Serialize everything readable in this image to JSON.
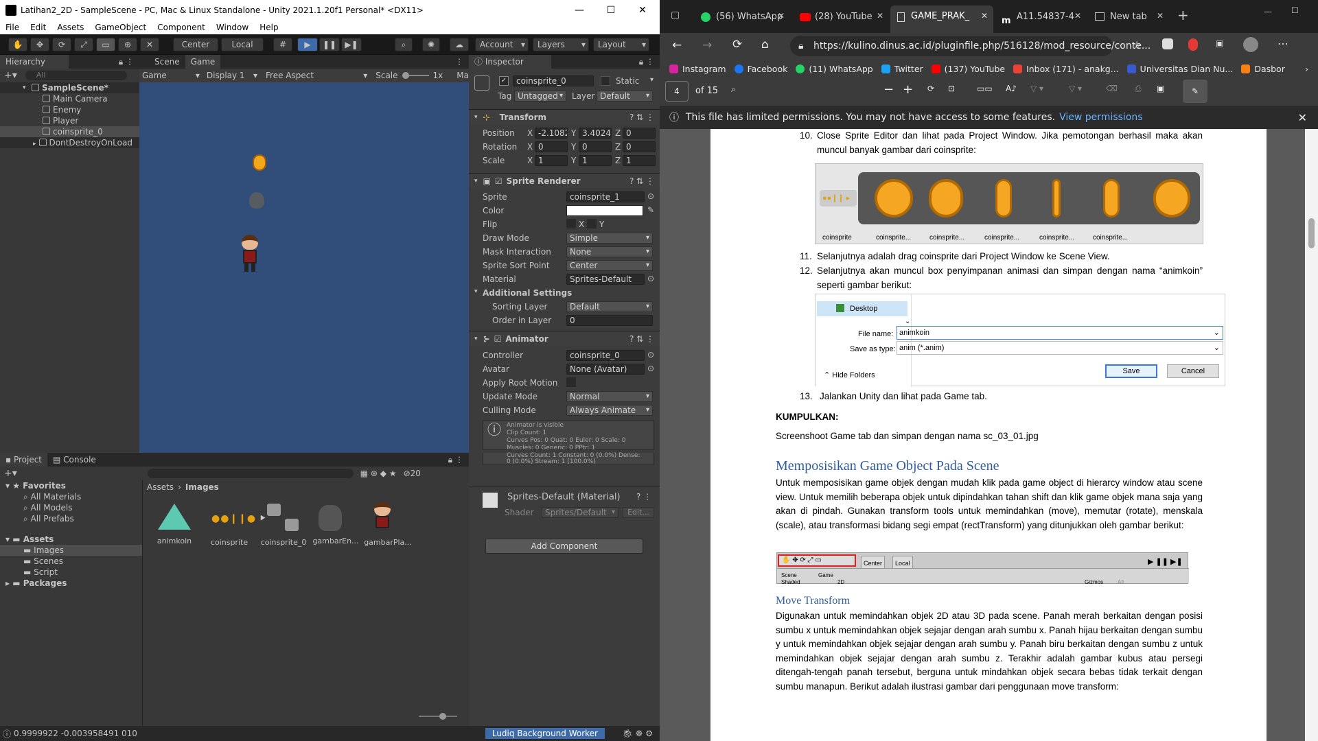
{
  "unity": {
    "title": "Latihan2_2D - SampleScene - PC, Mac & Linux Standalone - Unity 2021.1.20f1 Personal* <DX11>",
    "menu": [
      "File",
      "Edit",
      "Assets",
      "GameObject",
      "Component",
      "Window",
      "Help"
    ],
    "toolbar": {
      "center": "Center",
      "local": "Local",
      "account": "Account",
      "layers": "Layers",
      "layout": "Layout"
    },
    "hierarchy": {
      "tab": "Hierarchy",
      "search_placeholder": "All",
      "items": [
        "SampleScene*",
        "Main Camera",
        "Enemy",
        "Player",
        "coinsprite_0",
        "DontDestroyOnLoad"
      ]
    },
    "scene_tabs": {
      "scene": "Scene",
      "game": "Game"
    },
    "game_bar": {
      "game": "Game",
      "display": "Display 1",
      "aspect": "Free Aspect",
      "scale_label": "Scale",
      "scale_value": "1x",
      "maximize": "Ma"
    },
    "inspector": {
      "tab": "Inspector",
      "object_name": "coinsprite_0",
      "static": "Static",
      "tag_label": "Tag",
      "tag_value": "Untagged",
      "layer_label": "Layer",
      "layer_value": "Default",
      "transform": {
        "title": "Transform",
        "position_label": "Position",
        "pos_x": "-2.1082",
        "pos_y": "3.4024",
        "pos_z": "0",
        "rotation_label": "Rotation",
        "rot_x": "0",
        "rot_y": "0",
        "rot_z": "0",
        "scale_label": "Scale",
        "sc_x": "1",
        "sc_y": "1",
        "sc_z": "1"
      },
      "sprite_renderer": {
        "title": "Sprite Renderer",
        "sprite_label": "Sprite",
        "sprite_value": "coinsprite_1",
        "color_label": "Color",
        "flip_label": "Flip",
        "flip_x": "X",
        "flip_y": "Y",
        "draw_mode_label": "Draw Mode",
        "draw_mode": "Simple",
        "mask_label": "Mask Interaction",
        "mask": "None",
        "sort_point_label": "Sprite Sort Point",
        "sort_point": "Center",
        "material_label": "Material",
        "material": "Sprites-Default",
        "additional": "Additional Settings",
        "sorting_layer_label": "Sorting Layer",
        "sorting_layer": "Default",
        "order_label": "Order in Layer",
        "order": "0"
      },
      "animator": {
        "title": "Animator",
        "controller_label": "Controller",
        "controller": "coinsprite_0",
        "avatar_label": "Avatar",
        "avatar": "None (Avatar)",
        "apply_root_label": "Apply Root Motion",
        "update_label": "Update Mode",
        "update": "Normal",
        "culling_label": "Culling Mode",
        "culling": "Always Animate",
        "info": [
          "Animator is visible",
          "Clip Count: 1",
          "Curves Pos: 0 Quat: 0 Euler: 0 Scale: 0",
          "Muscles: 0 Generic: 0 PPtr: 1",
          "Curves Count: 1 Constant: 0 (0.0%) Dense:",
          "0 (0.0%) Stream: 1 (100.0%)"
        ]
      },
      "material_block": {
        "name": "Sprites-Default (Material)",
        "shader_label": "Shader",
        "shader": "Sprites/Default",
        "edit": "Edit..."
      },
      "add_component": "Add Component"
    },
    "project": {
      "tab_project": "Project",
      "tab_console": "Console",
      "hidden_count": "20",
      "tree": [
        {
          "label": "Favorites",
          "indent": 0,
          "bold": true
        },
        {
          "label": "All Materials",
          "indent": 1
        },
        {
          "label": "All Models",
          "indent": 1
        },
        {
          "label": "All Prefabs",
          "indent": 1
        },
        {
          "label": "Assets",
          "indent": 0,
          "bold": true
        },
        {
          "label": "Images",
          "indent": 1,
          "selected": true
        },
        {
          "label": "Scenes",
          "indent": 1
        },
        {
          "label": "Script",
          "indent": 1
        },
        {
          "label": "Packages",
          "indent": 0,
          "bold": true
        }
      ],
      "breadcrumb": [
        "Assets",
        "Images"
      ],
      "assets": [
        "animkoin",
        "coinsprite",
        "coinsprite_0",
        "gambarEn...",
        "gambarPla..."
      ]
    },
    "status": {
      "left": "0.9999922 -0.003958491 010",
      "worker": "Ludiq Background Worker"
    }
  },
  "browser": {
    "tabs": [
      {
        "label": "(56) WhatsApp",
        "icon": "whatsapp"
      },
      {
        "label": "(28) YouTube",
        "icon": "youtube"
      },
      {
        "label": "GAME_PRAK_",
        "icon": "document"
      },
      {
        "label": "A11.54837-4",
        "icon": "moodle"
      },
      {
        "label": "New tab",
        "icon": "newtab"
      }
    ],
    "url": "https://kulino.dinus.ac.id/pluginfile.php/516128/mod_resource/conte...",
    "favorites": [
      {
        "label": "Instagram",
        "color": "#d6249f"
      },
      {
        "label": "Facebook",
        "color": "#1877f2"
      },
      {
        "label": "(11) WhatsApp",
        "color": "#25d366"
      },
      {
        "label": "Twitter",
        "color": "#1da1f2"
      },
      {
        "label": "(137) YouTube",
        "color": "#ff0000"
      },
      {
        "label": "Inbox (171) - anakg...",
        "color": "#ea4335"
      },
      {
        "label": "Universitas Dian Nu...",
        "color": "#3a5bd0"
      },
      {
        "label": "Dasbor",
        "color": "#f98012"
      }
    ],
    "pdf": {
      "page": "4",
      "of": "of 15"
    },
    "permission": {
      "text": "This file has limited permissions. You may not have access to some features.",
      "link": "View permissions"
    }
  },
  "doc": {
    "item10_num": "10.",
    "item10": "Close Sprite Editor dan lihat pada Project Window. Jika pemotongan berhasil maka akan muncul banyak gambar dari coinsprite:",
    "coin_labels": [
      "coinsprite",
      "coinsprite...",
      "coinsprite...",
      "coinsprite...",
      "coinsprite...",
      "coinsprite..."
    ],
    "item11_num": "11.",
    "item11": "Selanjutnya adalah drag coinsprite dari Project Window ke Scene View.",
    "item12_num": "12.",
    "item12": "Selanjutnya akan muncul box penyimpanan animasi dan simpan dengan nama “animkoin” seperti gambar berikut:",
    "save_dialog": {
      "folder": "Desktop",
      "filename_label": "File name:",
      "filename": "animkoin",
      "type_label": "Save as type:",
      "type": "anim (*.anim)",
      "hide": "Hide Folders",
      "save": "Save",
      "cancel": "Cancel"
    },
    "item13_num": "13.",
    "item13": "Jalankan Unity dan lihat pada Game tab.",
    "kumpulkan": "KUMPULKAN:",
    "screenshot": "Screenshoot Game tab dan simpan dengan nama sc_03_01.jpg",
    "heading": "Memposisikan Game Object Pada Scene",
    "para1": "Untuk memposisikan game objek dengan mudah klik pada game object di hierarcy window atau scene view. Untuk memilih beberapa objek untuk dipindahkan tahan shift dan klik game objek mana saja yang akan di pindah. Gunakan transform tools untuk memindahkan (move), memutar (rotate), menskala (scale), atau transformasi bidang segi empat (rectTransform) yang ditunjukkan oleh gambar berikut:",
    "tool_center": "Center",
    "tool_local": "Local",
    "tool_scene": "Scene",
    "tool_game": "Game",
    "tool_shaded": "Shaded",
    "tool_2d": "2D",
    "tool_gizmos": "Gizmos",
    "tool_all": "All",
    "subheading": "Move Transform",
    "para2": "Digunakan untuk memindahkan objek 2D atau 3D pada scene. Panah merah berkaitan dengan posisi sumbu x untuk memindahkan objek sejajar dengan arah sumbu x. Panah hijau berkaitan dengan sumbu y untuk memindahkan objek sejajar dengan arah sumbu y. Panah biru berkaitan dengan sumbu z untuk memindahkan objek sejajar dengan arah sumbu z. Terakhir adalah gambar kubus atau persegi ditengah-tengah panah tersebut, berguna untuk mindahkan objek secara bebas tidak terkait dengan sumbu manapun. Berikut adalah ilustrasi gambar dari penggunaan move transform:"
  }
}
